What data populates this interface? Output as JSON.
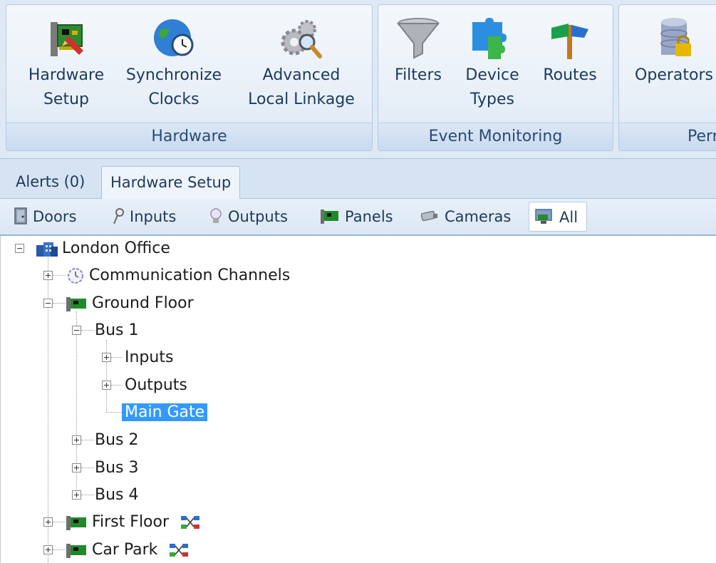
{
  "ribbon": {
    "groups": [
      {
        "label": "Hardware",
        "buttons": [
          {
            "label": "Hardware\nSetup",
            "icon": "circuit-board-icon"
          },
          {
            "label": "Synchronize\nClocks",
            "icon": "globe-clock-icon"
          },
          {
            "label": "Advanced\nLocal Linkage",
            "icon": "gears-magnifier-icon"
          }
        ]
      },
      {
        "label": "Event Monitoring",
        "buttons": [
          {
            "label": "Filters",
            "icon": "funnel-icon"
          },
          {
            "label": "Device\nTypes",
            "icon": "puzzle-pieces-icon"
          },
          {
            "label": "Routes",
            "icon": "signpost-icon"
          }
        ]
      },
      {
        "label": "Perr",
        "buttons": [
          {
            "label": "Operators",
            "icon": "database-lock-icon"
          }
        ]
      }
    ]
  },
  "tabs": [
    {
      "label": "Alerts (0)",
      "active": false
    },
    {
      "label": "Hardware Setup",
      "active": true
    }
  ],
  "filters": [
    {
      "label": "Doors",
      "icon": "door-icon",
      "active": false
    },
    {
      "label": "Inputs",
      "icon": "input-probe-icon",
      "active": false
    },
    {
      "label": "Outputs",
      "icon": "lightbulb-icon",
      "active": false
    },
    {
      "label": "Panels",
      "icon": "panel-board-icon",
      "active": false
    },
    {
      "label": "Cameras",
      "icon": "camera-icon",
      "active": false
    },
    {
      "label": "All",
      "icon": "all-devices-icon",
      "active": true
    }
  ],
  "tree": {
    "root": "London Office",
    "communication_channels": "Communication Channels",
    "ground_floor": "Ground Floor",
    "bus1": "Bus 1",
    "inputs": "Inputs",
    "outputs": "Outputs",
    "main_gate": "Main Gate",
    "bus2": "Bus 2",
    "bus3": "Bus 3",
    "bus4": "Bus 4",
    "first_floor": "First Floor",
    "car_park": "Car Park"
  },
  "colors": {
    "selection": "#3399ff",
    "ribbon_background": "#dfe9f5",
    "text": "#1e395b"
  }
}
